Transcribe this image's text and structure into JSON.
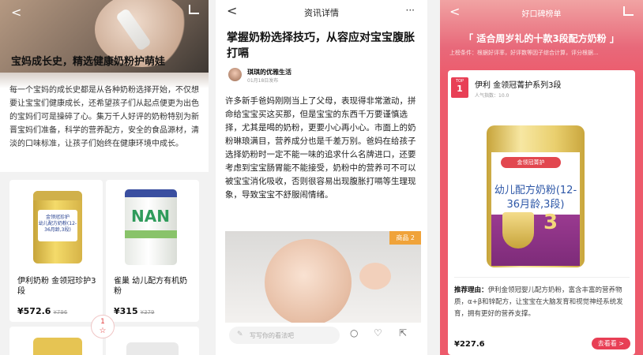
{
  "pane1": {
    "title": "宝妈成长史，精选健康奶粉护萌娃",
    "body": "每一个宝妈的成长史都是从各种奶粉选择开始，不仅想要让宝宝们健康成长，还希望孩子们从起点便更为出色的宝妈们可是操碎了心。集万千人好评的奶粉特别为新晋宝妈们准备，科学的营养配方，安全的食品源材，清淡的口味标准，让孩子们始终在健康环境中成长。",
    "products": [
      {
        "name": "伊利奶粉 金领冠珍护3段",
        "price": "¥572.6",
        "old_price": "¥796",
        "can_text": "幼儿配方奶粉(12-36月龄,3段)",
        "brand": "金领冠珍护"
      },
      {
        "name": "雀巢 幼儿配方有机奶粉",
        "price": "¥315",
        "old_price": "¥379",
        "can_text": "NAN"
      }
    ],
    "fav_count": "1",
    "fav_icon": "☆"
  },
  "pane2": {
    "header": "资讯详情",
    "title": "掌握奶粉选择技巧，从容应对宝宝腹胀打嗝",
    "author": "琪琪的优雅生活",
    "date": "01月18日发布",
    "body": "许多新手爸妈刚刚当上了父母，表现得非常激动，拼命给宝宝买这买那，但是宝宝的东西千万要谨慎选择，尤其是喝的奶粉，更要小心再小心。市面上的奶粉琳琅满目，营养成分也是千差万别。爸妈在给孩子选择奶粉时一定不能一味的追求什么名牌进口，还要考虑到宝宝肠胃能不能接受，奶粉中的营养可不可以被宝宝消化吸收，否则很容易出现腹胀打嗝等生理现象，导致宝宝不舒服闹情绪。",
    "tag": "商品 2",
    "comment_placeholder": "写写你的看法吧"
  },
  "pane3": {
    "header": "好口碑榜单",
    "title": "「 适合周岁礼的十款3段配方奶粉 」",
    "subtitle": "上榜条件：根据好评率，好评数等因子综合计算，评分根据...",
    "rank_top": "TOP",
    "rank": "1",
    "product": "伊利 金领冠菁护系列3段",
    "popularity": "人气指数：10.0",
    "can_brand": "金领冠菁护",
    "can_name": "幼儿配方奶粉(12-36月龄,3段)",
    "can_stage": "3",
    "reason_label": "推荐理由：",
    "reason": "伊利金领冠婴儿配方奶粉，富含丰富的营养物质，α+β和锌配方，让宝宝在大脑发育和视觉神经系统发育，拥有更好的营养支撑。",
    "price": "¥227.6",
    "cta": "去看看 >"
  }
}
